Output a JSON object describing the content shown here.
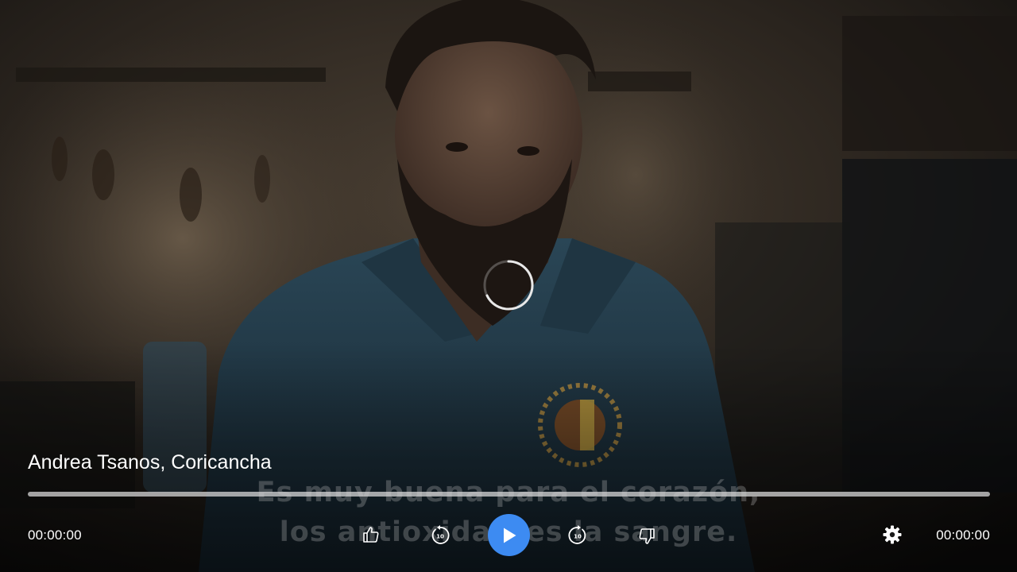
{
  "player": {
    "title": "Andrea Tsanos, Coricancha",
    "subtitles": [
      "Es muy buena para el corazón,",
      "los antioxidantes la sangre."
    ],
    "current_time": "00:00:00",
    "duration": "00:00:00",
    "progress": 0,
    "skip_back_seconds": "10",
    "skip_forward_seconds": "10",
    "status": "loading"
  },
  "icons": {
    "like": "thumbs-up-icon",
    "rewind": "rewind-10-icon",
    "play": "play-icon",
    "forward": "forward-10-icon",
    "dislike": "thumbs-down-icon",
    "settings": "gear-icon",
    "loading": "loading-spinner-icon"
  },
  "colors": {
    "accent": "#3d8bf2",
    "text": "#ffffff",
    "progress_track": "#d7d7d7"
  }
}
